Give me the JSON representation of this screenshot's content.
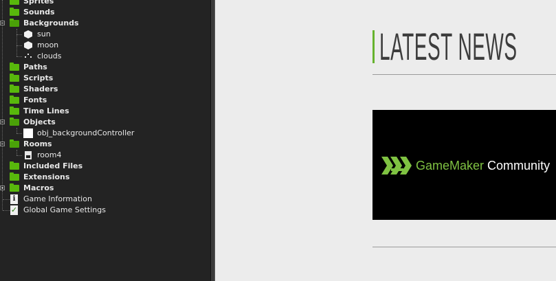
{
  "resource_tree": {
    "items": [
      {
        "label": "Sprites",
        "kind": "folder"
      },
      {
        "label": "Sounds",
        "kind": "folder"
      },
      {
        "label": "Backgrounds",
        "kind": "folder-open"
      },
      {
        "label": "sun",
        "kind": "background"
      },
      {
        "label": "moon",
        "kind": "background"
      },
      {
        "label": "clouds",
        "kind": "background-dots"
      },
      {
        "label": "Paths",
        "kind": "folder"
      },
      {
        "label": "Scripts",
        "kind": "folder"
      },
      {
        "label": "Shaders",
        "kind": "folder"
      },
      {
        "label": "Fonts",
        "kind": "folder"
      },
      {
        "label": "Time Lines",
        "kind": "folder"
      },
      {
        "label": "Objects",
        "kind": "folder-open"
      },
      {
        "label": "obj_backgroundController",
        "kind": "object"
      },
      {
        "label": "Rooms",
        "kind": "folder-open"
      },
      {
        "label": "room4",
        "kind": "room"
      },
      {
        "label": "Included Files",
        "kind": "folder"
      },
      {
        "label": "Extensions",
        "kind": "folder"
      },
      {
        "label": "Macros",
        "kind": "folder"
      },
      {
        "label": "Game Information",
        "kind": "info"
      },
      {
        "label": "Global Game Settings",
        "kind": "settings"
      }
    ]
  },
  "news": {
    "title": "LATEST NEWS",
    "banner_brand": "GameMaker",
    "banner_suffix": "Community"
  },
  "colors": {
    "accent_green": "#66b32e",
    "folder_green": "#58b80c",
    "panel_bg": "#232323",
    "page_bg": "#ececec"
  }
}
